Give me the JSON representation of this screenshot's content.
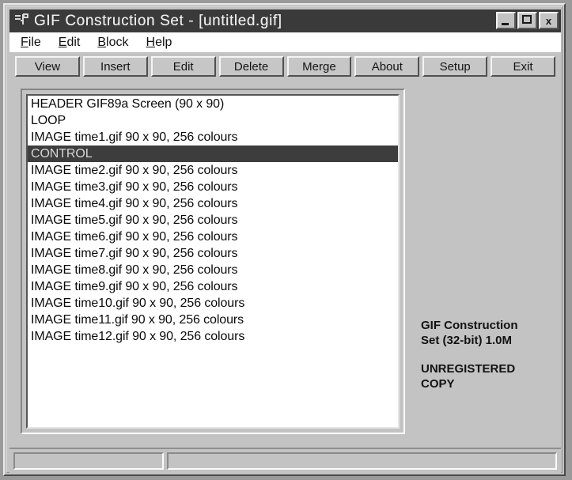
{
  "window": {
    "title": "GIF Construction Set - [untitled.gif]",
    "sysmenu_icon": "app-document-icon",
    "controls": {
      "minimize_label": "_",
      "minimize_icon": "minimize-icon",
      "maximize_label": "□",
      "maximize_icon": "maximize-icon",
      "close_label": "x",
      "close_icon": "close-icon"
    }
  },
  "menubar": {
    "items": [
      {
        "accel": "F",
        "rest": "ile"
      },
      {
        "accel": "E",
        "rest": "dit"
      },
      {
        "accel": "B",
        "rest": "lock"
      },
      {
        "accel": "H",
        "rest": "elp"
      }
    ]
  },
  "toolbar": {
    "buttons": [
      {
        "label": "View",
        "name": "view"
      },
      {
        "label": "Insert",
        "name": "insert"
      },
      {
        "label": "Edit",
        "name": "edit"
      },
      {
        "label": "Delete",
        "name": "delete"
      },
      {
        "label": "Merge",
        "name": "merge"
      },
      {
        "label": "About",
        "name": "about"
      },
      {
        "label": "Setup",
        "name": "setup"
      },
      {
        "label": "Exit",
        "name": "exit"
      }
    ]
  },
  "blocklist": {
    "rows": [
      {
        "text": "HEADER GIF89a Screen (90 x 90)",
        "selected": false
      },
      {
        "text": "LOOP",
        "selected": false
      },
      {
        "text": "IMAGE time1.gif 90 x 90, 256 colours",
        "selected": false
      },
      {
        "text": "CONTROL",
        "selected": true
      },
      {
        "text": "IMAGE time2.gif 90 x 90, 256 colours",
        "selected": false
      },
      {
        "text": "IMAGE time3.gif 90 x 90, 256 colours",
        "selected": false
      },
      {
        "text": "IMAGE time4.gif 90 x 90, 256 colours",
        "selected": false
      },
      {
        "text": "IMAGE time5.gif 90 x 90, 256 colours",
        "selected": false
      },
      {
        "text": "IMAGE time6.gif 90 x 90, 256 colours",
        "selected": false
      },
      {
        "text": "IMAGE time7.gif 90 x 90, 256 colours",
        "selected": false
      },
      {
        "text": "IMAGE time8.gif 90 x 90, 256 colours",
        "selected": false
      },
      {
        "text": "IMAGE time9.gif 90 x 90, 256 colours",
        "selected": false
      },
      {
        "text": "IMAGE time10.gif 90 x 90, 256 colours",
        "selected": false
      },
      {
        "text": "IMAGE time11.gif 90 x 90, 256 colours",
        "selected": false
      },
      {
        "text": "IMAGE time12.gif 90 x 90, 256 colours",
        "selected": false
      }
    ]
  },
  "info_panel": {
    "product_line1": "GIF Construction",
    "product_line2": "Set (32-bit) 1.0M",
    "status_line1": "UNREGISTERED",
    "status_line2": "COPY"
  },
  "statusbar": {
    "left_text": "",
    "right_text": ""
  },
  "colors": {
    "face": "#c3c3c3",
    "titlebar": "#3a3a3a",
    "title_text": "#ededed",
    "selection": "#3d3d3d",
    "selection_text": "#d6d6d6",
    "list_bg": "#ffffff",
    "desktop": "#9a9a9a"
  }
}
